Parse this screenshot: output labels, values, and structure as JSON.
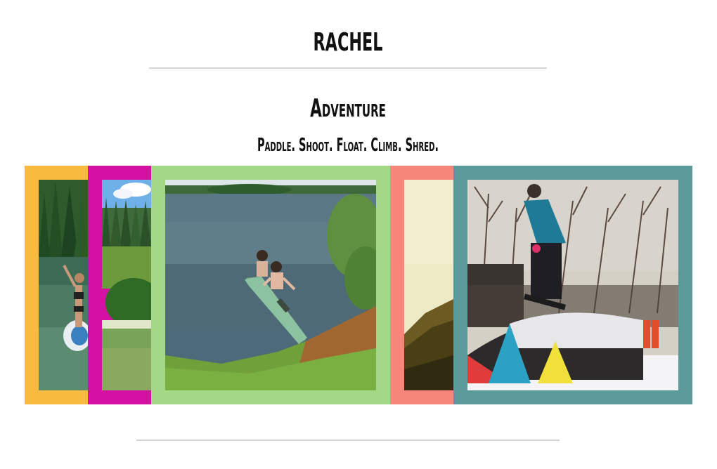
{
  "header": {
    "site_title": "RACHEL"
  },
  "section": {
    "title": "Adventure",
    "tagline": "Paddle. Shoot. Float. Climb. Shred."
  },
  "gallery": {
    "cards": [
      {
        "color": "#f9bb3f",
        "icon": "paddleboard-photo"
      },
      {
        "color": "#d312a4",
        "icon": "forest-photo"
      },
      {
        "color": "#a3d887",
        "icon": "canoe-photo"
      },
      {
        "color": "#f6857a",
        "icon": "hillside-photo"
      },
      {
        "color": "#5b9a9b",
        "icon": "snowboard-photo"
      }
    ]
  }
}
